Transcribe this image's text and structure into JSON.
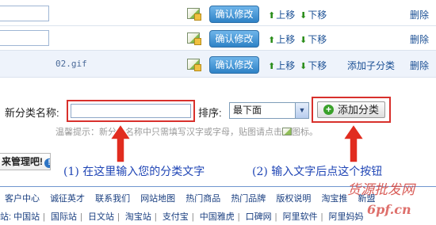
{
  "category_rows": [
    {
      "filename": "",
      "confirm_label": "确认修改",
      "move_up": "上移",
      "move_down": "下移",
      "add_sub": "",
      "delete": "删除"
    },
    {
      "filename": "",
      "confirm_label": "确认修改",
      "move_up": "上移",
      "move_down": "下移",
      "add_sub": "",
      "delete": "删除"
    },
    {
      "filename": "02.gif",
      "confirm_label": "确认修改",
      "move_up": "上移",
      "move_down": "下移",
      "add_sub": "添加子分类",
      "delete": "删除"
    }
  ],
  "form": {
    "new_category_label": "新分类名称:",
    "new_category_value": "",
    "order_label": "排序:",
    "order_selected": "最下面",
    "add_button_label": "添加分类",
    "hint": "温馨提示：新分类名称中只需填写汉字或字母，贴图请点击",
    "hint_icon_suffix": "图标。"
  },
  "tip": {
    "text": "来管理吧!"
  },
  "annotations": {
    "caption_1": "(1) 在这里输入您的分类文字",
    "caption_2": "(2) 输入文字后点这个按钮"
  },
  "footer": {
    "links": [
      "客户中心",
      "诚征英才",
      "联系我们",
      "网站地图",
      "热门商品",
      "热门品牌",
      "版权说明",
      "淘宝推",
      "新盟"
    ],
    "friend_prefix": "站:",
    "friend_links": [
      "中国站",
      "国际站",
      "日文站",
      "淘宝站",
      "支付宝",
      "中国雅虎",
      "口碑网",
      "阿里软件",
      "阿里妈妈"
    ]
  },
  "watermark": {
    "text": "货源批发网",
    "url": "6pf.cn"
  },
  "colors": {
    "accent_red": "#d8302c",
    "link_blue": "#1a4f94",
    "caption_blue": "#1f45b5",
    "button_blue": "#2e82c6"
  }
}
